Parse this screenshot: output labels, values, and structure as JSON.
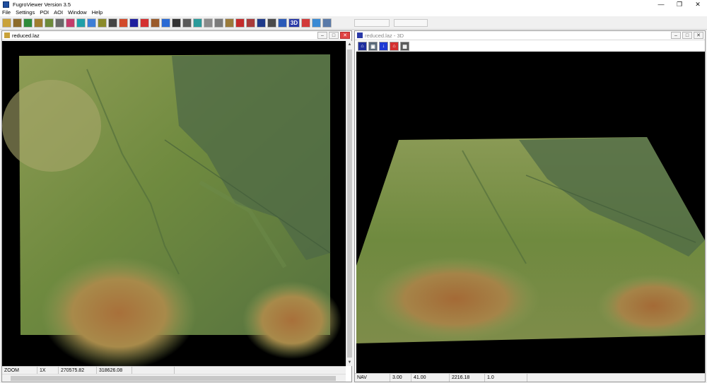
{
  "app": {
    "title": "FugroViewer  Version 3.5"
  },
  "menu": [
    "File",
    "Settings",
    "POI",
    "AOI",
    "Window",
    "Help"
  ],
  "toolbar": {
    "buttons": [
      {
        "name": "open-icon",
        "color": "#c9a23a"
      },
      {
        "name": "save-icon",
        "color": "#8c6b2b"
      },
      {
        "name": "redo-icon",
        "color": "#2e8b3a"
      },
      {
        "name": "load-icon",
        "color": "#a07d2e"
      },
      {
        "name": "export-icon",
        "color": "#6d8a3a"
      },
      {
        "name": "grid-icon",
        "color": "#6a6a6a"
      },
      {
        "name": "contour-icon",
        "color": "#c43c6c"
      },
      {
        "name": "surface-icon",
        "color": "#1f9fa8"
      },
      {
        "name": "ramp-icon",
        "color": "#3d7dd6"
      },
      {
        "name": "intensity-icon",
        "color": "#8a8a2a"
      },
      {
        "name": "profile-icon",
        "color": "#444444"
      },
      {
        "name": "colorize-icon",
        "color": "#d24a2a"
      },
      {
        "name": "classes-icon",
        "color": "#1e1e9e"
      },
      {
        "name": "rainbow-icon",
        "color": "#d43030"
      },
      {
        "name": "hillshade-icon",
        "color": "#9a5a2a"
      },
      {
        "name": "palette-icon",
        "color": "#2a6ad4"
      },
      {
        "name": "points-icon",
        "color": "#333333"
      },
      {
        "name": "grid-select-icon",
        "color": "#5a5a5a"
      },
      {
        "name": "tin-icon",
        "color": "#2a9a9a"
      },
      {
        "name": "pan-hand-icon",
        "color": "#8a8a8a"
      },
      {
        "name": "zoom-icon",
        "color": "#7a7a7a"
      },
      {
        "name": "zoom-window-icon",
        "color": "#9a7a3a"
      },
      {
        "name": "poi-pin-icon",
        "color": "#c42a2a"
      },
      {
        "name": "target-icon",
        "color": "#a83a3a"
      },
      {
        "name": "query-icon",
        "color": "#1e3a8a"
      },
      {
        "name": "measure-icon",
        "color": "#4a4a4a"
      },
      {
        "name": "pencil-icon",
        "color": "#2a5ab8"
      },
      {
        "name": "view-3d-icon",
        "color": "#2a3aa8"
      },
      {
        "name": "stop-icon",
        "color": "#d23a3a"
      },
      {
        "name": "layers-icon",
        "color": "#3a8ad4"
      },
      {
        "name": "stack-icon",
        "color": "#5a7aa8"
      }
    ],
    "label_3d": "3D"
  },
  "window_2d": {
    "title": "reduced.laz",
    "status": [
      "ZOOM",
      "1X",
      "270575.82",
      "318626.08"
    ]
  },
  "window_3d": {
    "title": "reduced.laz - 3D",
    "status": [
      "NAV",
      "3.00",
      "41.00",
      "2216.18",
      "1.0"
    ]
  },
  "colors": {
    "terrain_low": "#6f8a3f",
    "terrain_mid": "#5d7a4c",
    "terrain_dark": "#4d6448",
    "terrain_high": "#a8743e",
    "terrain_pale": "#9aa65e"
  }
}
